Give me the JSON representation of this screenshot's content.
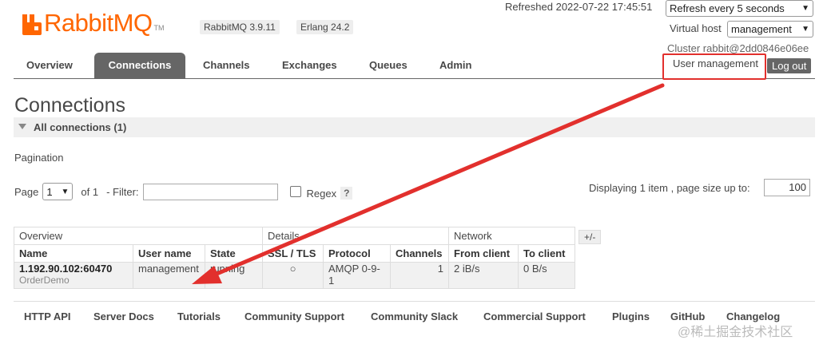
{
  "header": {
    "logo_text": "RabbitMQ",
    "logo_tm": "TM",
    "version_badge": "RabbitMQ 3.9.11",
    "erlang_badge": "Erlang 24.2",
    "refreshed": "Refreshed 2022-07-22 17:45:51",
    "refresh_select": "Refresh every 5 seconds",
    "vhost_label": "Virtual host",
    "vhost_select": "management",
    "cluster": "Cluster rabbit@2dd0846e06ee",
    "user_management": "User management",
    "logout": "Log out"
  },
  "nav": {
    "tabs": [
      "Overview",
      "Connections",
      "Channels",
      "Exchanges",
      "Queues",
      "Admin"
    ],
    "active": "Connections"
  },
  "page": {
    "title": "Connections",
    "section": "All connections (1)",
    "pagination_title": "Pagination",
    "page_label": "Page",
    "page_value": "1",
    "of_label": "of 1",
    "filter_label": "- Filter:",
    "filter_value": "",
    "regex_label": "Regex",
    "help": "?",
    "displaying": "Displaying 1 item , page size up to:",
    "page_size": "100"
  },
  "table": {
    "groups": [
      "Overview",
      "Details",
      "Network"
    ],
    "headers": [
      "Name",
      "User name",
      "State",
      "SSL / TLS",
      "Protocol",
      "Channels",
      "From client",
      "To client"
    ],
    "row": {
      "name": "1.192.90.102:60470",
      "name_sub": "OrderDemo",
      "user": "management",
      "state": "running",
      "ssl": "○",
      "protocol": "AMQP 0-9-1",
      "channels": "1",
      "from_client": "2 iB/s",
      "to_client": "0 B/s"
    },
    "plusminus": "+/-"
  },
  "footer": {
    "links": [
      "HTTP API",
      "Server Docs",
      "Tutorials",
      "Community Support",
      "Community Slack",
      "Commercial Support",
      "Plugins",
      "GitHub",
      "Changelog"
    ]
  },
  "watermark": "@稀土掘金技术社区",
  "colors": {
    "accent": "#ff6600",
    "annotation_red": "#e2302d",
    "tab_active": "#666666"
  }
}
